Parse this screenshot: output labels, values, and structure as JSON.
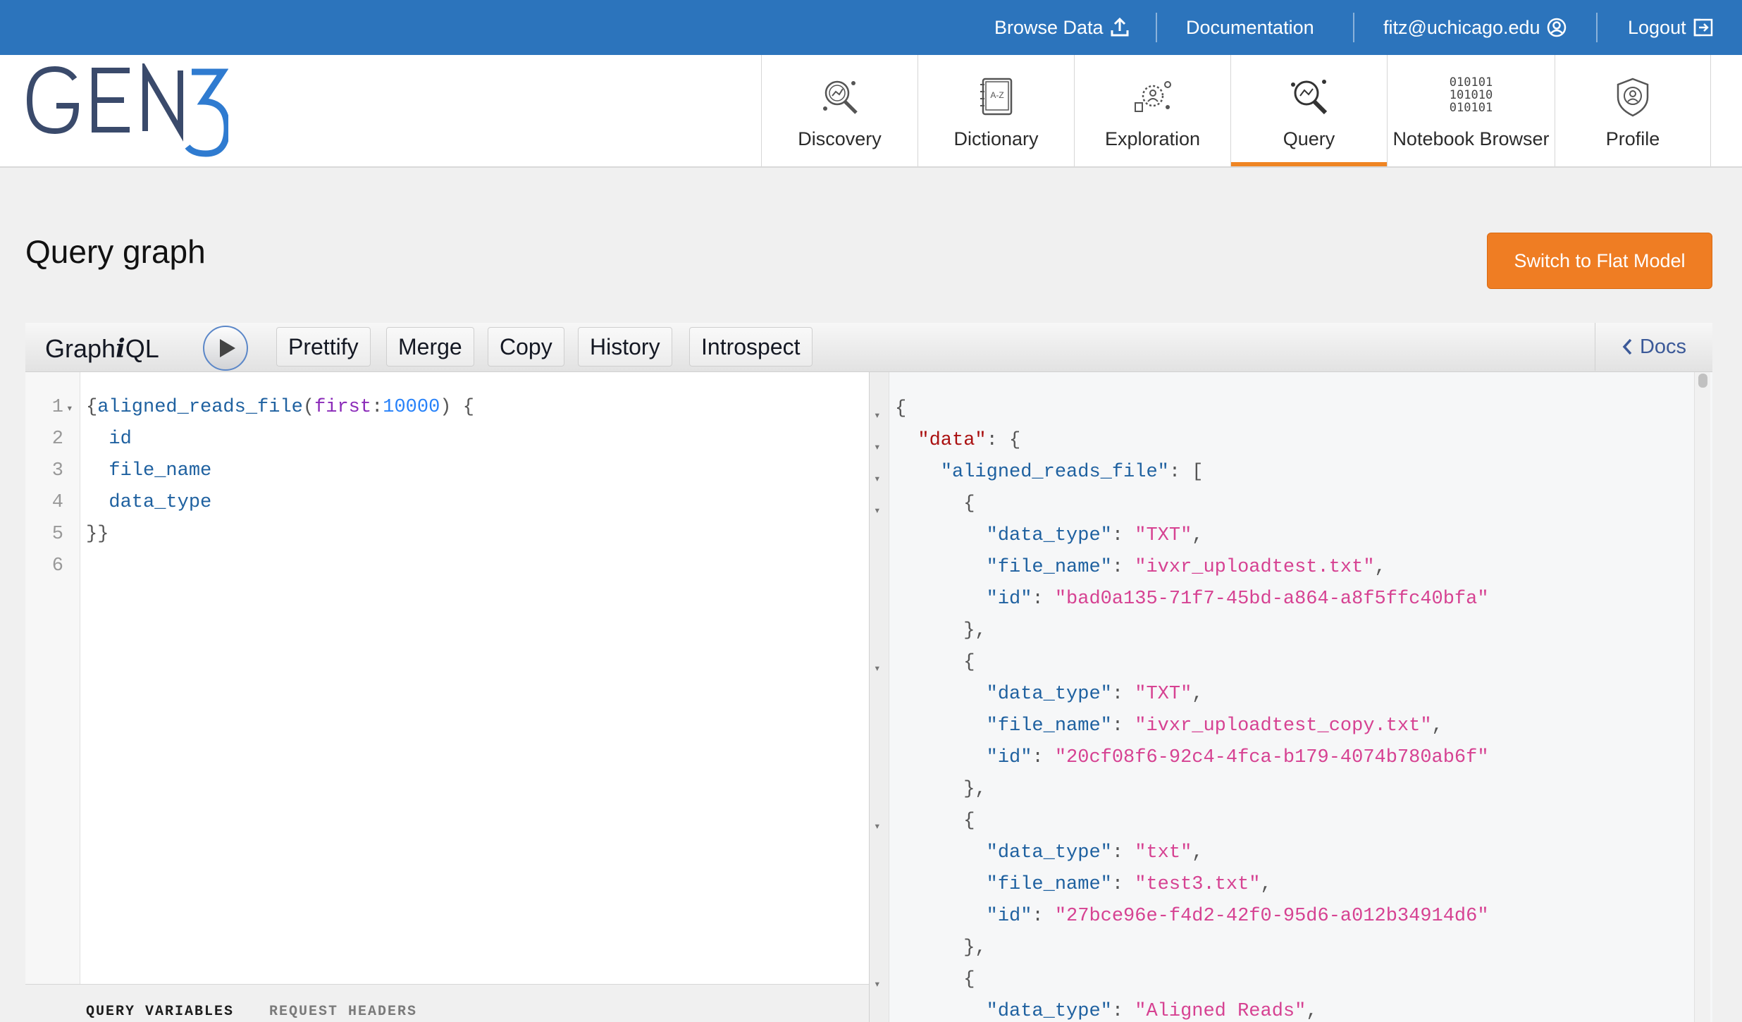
{
  "topbar": {
    "browse_data": "Browse Data",
    "documentation": "Documentation",
    "user_email": "fitz@uchicago.edu",
    "logout": "Logout"
  },
  "logo": {
    "text": "GEN3"
  },
  "nav": {
    "tabs": [
      {
        "label": "Discovery",
        "icon": "discovery-icon"
      },
      {
        "label": "Dictionary",
        "icon": "dictionary-icon"
      },
      {
        "label": "Exploration",
        "icon": "exploration-icon"
      },
      {
        "label": "Query",
        "icon": "query-icon",
        "active": true
      },
      {
        "label": "Notebook Browser",
        "icon": "binary-icon"
      },
      {
        "label": "Profile",
        "icon": "profile-shield-icon"
      }
    ],
    "binary_icon_lines": [
      "010101",
      "101010",
      "010101"
    ],
    "dictionary_icon_text": "A-Z",
    "active_color": "#ef8523"
  },
  "page": {
    "title": "Query graph",
    "switch_button": "Switch to Flat Model",
    "accent_color": "#ef7d23"
  },
  "graphiql": {
    "title_prefix": "Graph",
    "title_i": "i",
    "title_suffix": "QL",
    "buttons": {
      "prettify": "Prettify",
      "merge": "Merge",
      "copy": "Copy",
      "history": "History",
      "introspect": "Introspect"
    },
    "docs": "Docs",
    "line_numbers": [
      "1",
      "2",
      "3",
      "4",
      "5",
      "6"
    ],
    "query": {
      "open": "{",
      "field": "aligned_reads_file",
      "paren_open": "(",
      "arg": "first",
      "colon": ":",
      "value": "10000",
      "paren_close_brace": ") {",
      "fields": [
        "id",
        "file_name",
        "data_type"
      ],
      "close": "}}"
    },
    "vars_tabs": {
      "query_variables": "QUERY VARIABLES",
      "request_headers": "REQUEST HEADERS"
    }
  },
  "result": {
    "root_key": "\"data\"",
    "list_key": "\"aligned_reads_file\"",
    "key_data_type": "\"data_type\"",
    "key_file_name": "\"file_name\"",
    "key_id": "\"id\"",
    "records": [
      {
        "data_type": "\"TXT\"",
        "file_name": "\"ivxr_uploadtest.txt\"",
        "id": "\"bad0a135-71f7-45bd-a864-a8f5ffc40bfa\""
      },
      {
        "data_type": "\"TXT\"",
        "file_name": "\"ivxr_uploadtest_copy.txt\"",
        "id": "\"20cf08f6-92c4-4fca-b179-4074b780ab6f\""
      },
      {
        "data_type": "\"txt\"",
        "file_name": "\"test3.txt\"",
        "id": "\"27bce96e-f4d2-42f0-95d6-a012b34914d6\""
      },
      {
        "data_type": "\"Aligned Reads\""
      }
    ]
  }
}
